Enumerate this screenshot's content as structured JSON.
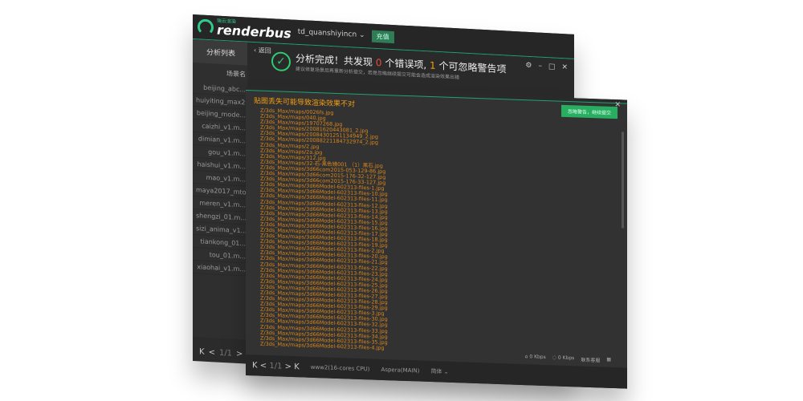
{
  "app": {
    "brand": "renderbus",
    "brand_sub": "瑞云渲染",
    "user": "td_quanshiyincn",
    "recharge": "充值"
  },
  "sidebar": {
    "tab": "分析列表",
    "column": "场景名",
    "items": [
      "beijing_abc...",
      "huiyiting_max2018_...",
      "beijing_mode...",
      "caizhi_v1.m...",
      "dimian_v1.m...",
      "gou_v1.m...",
      "haishui_v1.m...",
      "mao_v1.m...",
      "maya2017_mtoa...",
      "meren_v1.m...",
      "shengzi_01.m...",
      "sizi_anima_v1...",
      "tiankong_01...",
      "tou_01.m...",
      "xiaohai_v1.m..."
    ]
  },
  "pager": {
    "first": "K",
    "prev": "<",
    "page": "1/1",
    "next": ">",
    "last": "K"
  },
  "result": {
    "back": "返回",
    "title_prefix": "分析完成！共发现",
    "errors": "0",
    "errors_label": "个错误项,",
    "warnings": "1",
    "warnings_label": "个可忽略警告项",
    "subtitle": "建议修复场景后再重新分析提交，若是忽略继续提交可能会造成渲染效果出错"
  },
  "window_controls": [
    "⚙",
    "–",
    "□",
    "✕"
  ],
  "dialog": {
    "title": "贴图丢失可能导致渲染效果不对",
    "close": "✕",
    "confirm": "忽略警告，继续提交",
    "files": [
      "Z/3ds_Max/maps/0026fs.jpg",
      "Z/3ds_Max/maps/040.jpg",
      "Z/3ds_Max/maps/19707268.jpg",
      "Z/3ds_Max/maps/20081620443081_2.jpg",
      "Z/3ds_Max/maps/20084301251134949_2.jpg",
      "Z/3ds_Max/maps/20088221184732974_2.jpg",
      "Z/3ds_Max/maps/2.jpg",
      "Z/3ds_Max/maps/2a.jpg",
      "Z/3ds_Max/maps/312.jpg",
      "Z/3ds_Max/maps/32-石-黑色镜001 （1）黑石.jpg",
      "Z/3ds_Max/maps/3d66com2015-053-129-86.jpg",
      "Z/3ds_Max/maps/3d66com2015-176-32-127.jpg",
      "Z/3ds_Max/maps/3d66com2015-176-33-127.jpg",
      "Z/3ds_Max/maps/3d66Model-602313-files-1.jpg",
      "Z/3ds_Max/maps/3d66Model-602313-files-10.jpg",
      "Z/3ds_Max/maps/3d66Model-602313-files-11.jpg",
      "Z/3ds_Max/maps/3d66Model-602313-files-12.jpg",
      "Z/3ds_Max/maps/3d66Model-602313-files-13.jpg",
      "Z/3ds_Max/maps/3d66Model-602313-files-14.jpg",
      "Z/3ds_Max/maps/3d66Model-602313-files-15.jpg",
      "Z/3ds_Max/maps/3d66Model-602313-files-16.jpg",
      "Z/3ds_Max/maps/3d66Model-602313-files-17.jpg",
      "Z/3ds_Max/maps/3d66Model-602313-files-18.jpg",
      "Z/3ds_Max/maps/3d66Model-602313-files-19.jpg",
      "Z/3ds_Max/maps/3d66Model-602313-files-2.jpg",
      "Z/3ds_Max/maps/3d66Model-602313-files-20.jpg",
      "Z/3ds_Max/maps/3d66Model-602313-files-21.jpg",
      "Z/3ds_Max/maps/3d66Model-602313-files-22.jpg",
      "Z/3ds_Max/maps/3d66Model-602313-files-23.jpg",
      "Z/3ds_Max/maps/3d66Model-602313-files-24.jpg",
      "Z/3ds_Max/maps/3d66Model-602313-files-25.jpg",
      "Z/3ds_Max/maps/3d66Model-602313-files-26.jpg",
      "Z/3ds_Max/maps/3d66Model-602313-files-27.jpg",
      "Z/3ds_Max/maps/3d66Model-602313-files-28.jpg",
      "Z/3ds_Max/maps/3d66Model-602313-files-29.jpg",
      "Z/3ds_Max/maps/3d66Model-602313-files-3.jpg",
      "Z/3ds_Max/maps/3d66Model-602313-files-30.jpg",
      "Z/3ds_Max/maps/3d66Model-602313-files-32.jpg",
      "Z/3ds_Max/maps/3d66Model-602313-files-33.jpg",
      "Z/3ds_Max/maps/3d66Model-602313-files-34.jpg",
      "Z/3ds_Max/maps/3d66Model-602313-files-35.jpg",
      "Z/3ds_Max/maps/3d66Model-602313-files-4.jpg"
    ]
  },
  "footer": {
    "cpu": "www2(16-cores CPU)",
    "transfer": "Aspera(MAIN)",
    "lang": "简体",
    "down": "0 Kbps",
    "up": "0 Kbps",
    "feedback": "联系客服"
  },
  "colors": {
    "accent": "#1ea672",
    "error": "#e74c3c",
    "warning": "#f39c12"
  }
}
